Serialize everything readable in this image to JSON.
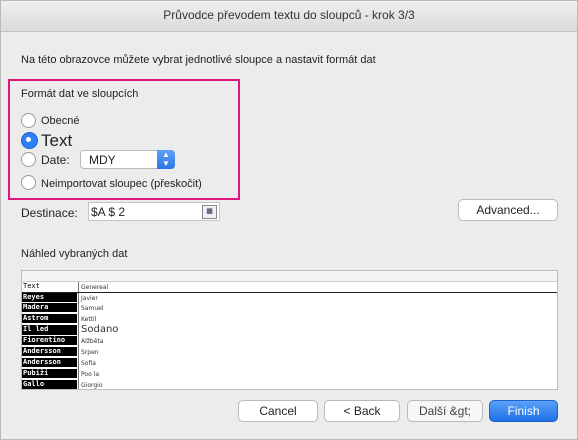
{
  "window": {
    "title": "Průvodce převodem textu do sloupců - krok 3/3"
  },
  "instructions": "Na této obrazovce můžete vybrat jednotlivé sloupce a nastavit formát dat",
  "format_group": {
    "label": "Formát dat ve sloupcích",
    "options": [
      {
        "label": "Obecné",
        "selected": false
      },
      {
        "label": "Text",
        "selected": true
      },
      {
        "label": "Date:",
        "selected": false
      },
      {
        "label": "Neimportovat sloupec (přeskočit)",
        "selected": false
      }
    ],
    "date_format": "MDY"
  },
  "destination": {
    "label": "Destinace:",
    "value": "$A $ 2"
  },
  "advanced_button": "Advanced...",
  "preview": {
    "label": "Náhled vybraných dat",
    "col1_header": "Text",
    "col2_header": "Genereal",
    "rows": [
      {
        "c1": "Reyes",
        "c2": "Javier"
      },
      {
        "c1": "Madera",
        "c2": "Samuel"
      },
      {
        "c1": "Astrom",
        "c2": "Kettil"
      },
      {
        "c1": "Il led",
        "c2": "Sodano"
      },
      {
        "c1": "Fiorentino",
        "c2": "Alžběta"
      },
      {
        "c1": "Andersson",
        "c2": "Srpen"
      },
      {
        "c1": "Andersson",
        "c2": "Sofia"
      },
      {
        "c1": "Pubiži",
        "c2": "Poo la"
      },
      {
        "c1": "Gallo",
        "c2": "Giorgio"
      }
    ]
  },
  "buttons": {
    "cancel": "Cancel",
    "back": "< Back",
    "next": "Další &gt;",
    "finish": "Finish"
  },
  "colors": {
    "accent": "#2d7ff5",
    "highlight": "#e0157f"
  }
}
